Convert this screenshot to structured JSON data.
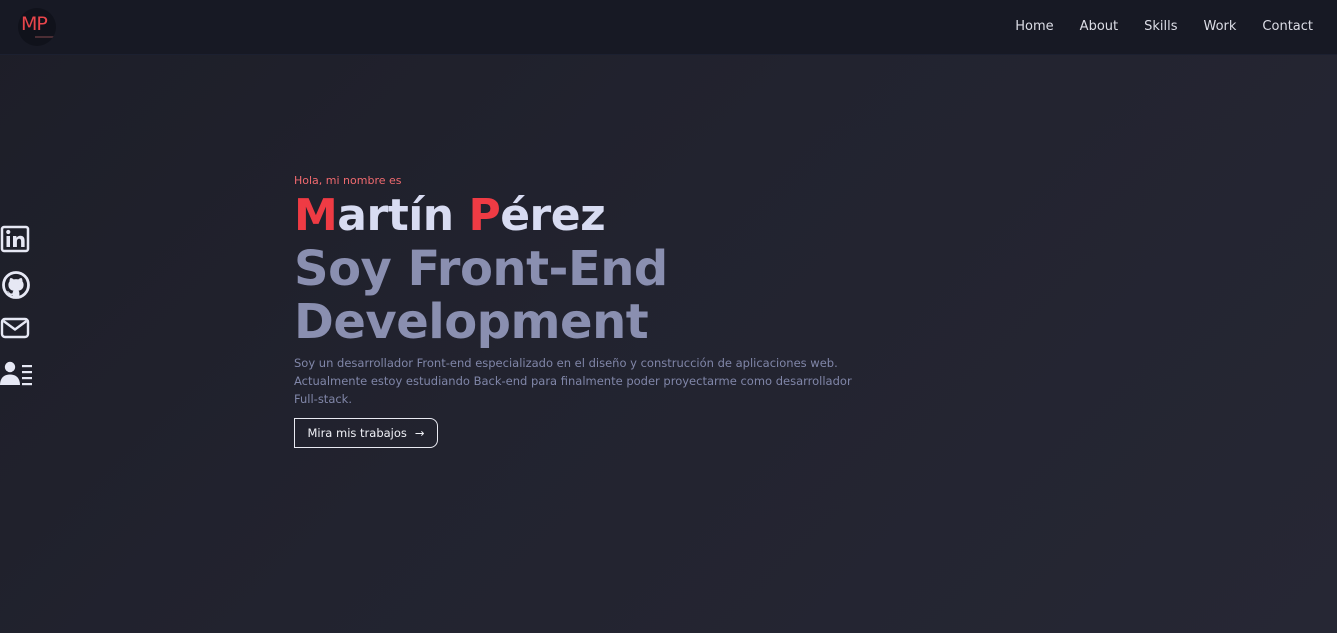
{
  "header": {
    "logo_text": "MP",
    "nav": [
      {
        "label": "Home"
      },
      {
        "label": "About"
      },
      {
        "label": "Skills"
      },
      {
        "label": "Work"
      },
      {
        "label": "Contact"
      }
    ]
  },
  "social": [
    {
      "icon": "linkedin-icon"
    },
    {
      "icon": "github-icon"
    },
    {
      "icon": "mail-icon"
    },
    {
      "icon": "resume-icon"
    }
  ],
  "hero": {
    "greeting": "Hola, mi nombre es",
    "name_first_initial": "M",
    "name_first_rest": "artín ",
    "name_last_initial": "P",
    "name_last_rest": "érez",
    "role_line1": "Soy Front-End",
    "role_line2": "Development",
    "description": "Soy un desarrollador Front-end especializado en el diseño y construcción de aplicaciones web. Actualmente estoy estudiando Back-end para finalmente poder proyectarme como desarrollador Full-stack.",
    "cta_label": "Mira mis trabajos",
    "cta_arrow": "→"
  },
  "colors": {
    "accent": "#ef3b44",
    "background": "#22232f",
    "navbar": "#171924",
    "name": "#d8dcf2",
    "role": "#8a8fb0"
  }
}
